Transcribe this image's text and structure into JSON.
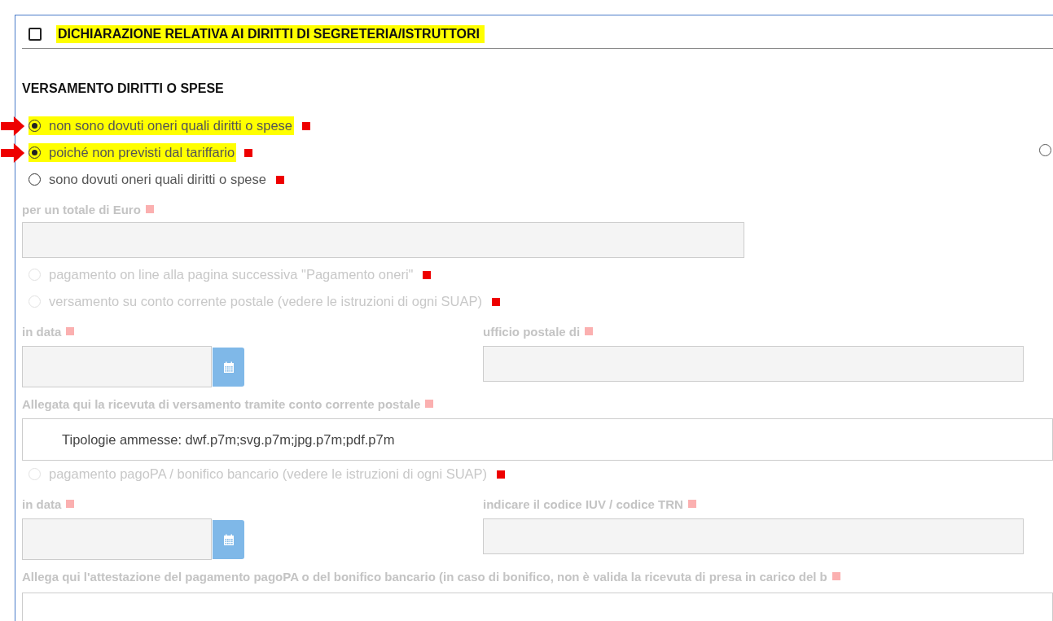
{
  "section": {
    "title": "DICHIARAZIONE RELATIVA AI DIRITTI DI SEGRETERIA/ISTRUTTORI",
    "checked": false,
    "highlighted": true
  },
  "heading": "VERSAMENTO DIRITTI O SPESE",
  "side_radio": {
    "selected": false
  },
  "rows": [
    {
      "kind": "radio",
      "label": "non sono dovuti oneri quali diritti o spese",
      "selected": true,
      "disabled": false,
      "highlighted": true,
      "arrow": true
    },
    {
      "kind": "radio",
      "label": "poiché non previsti dal tariffario",
      "selected": true,
      "disabled": false,
      "highlighted": true,
      "arrow": true
    },
    {
      "kind": "radio",
      "label": "sono dovuti oneri quali diritti o spese",
      "selected": false,
      "disabled": false,
      "highlighted": false,
      "arrow": false
    },
    {
      "kind": "field",
      "label": "per un totale di Euro",
      "disabled": true
    },
    {
      "kind": "radio",
      "label": "pagamento on line alla pagina successiva \"Pagamento oneri\"",
      "selected": false,
      "disabled": true,
      "highlighted": false,
      "arrow": false
    },
    {
      "kind": "radio",
      "label": "versamento su conto corrente postale (vedere le istruzioni di ogni SUAP)",
      "selected": false,
      "disabled": true,
      "highlighted": false,
      "arrow": false
    },
    {
      "kind": "pair",
      "left": {
        "label": "in data",
        "disabled": true
      },
      "right": {
        "label": "ufficio postale di",
        "disabled": true
      }
    },
    {
      "kind": "file",
      "label": "Allegata qui la ricevuta di versamento tramite conto corrente postale",
      "disabled": true,
      "placeholder": "Tipologie ammesse: dwf.p7m;svg.p7m;jpg.p7m;pdf.p7m"
    },
    {
      "kind": "radio",
      "label": "pagamento pagoPA / bonifico bancario (vedere le istruzioni di ogni SUAP)",
      "selected": false,
      "disabled": true,
      "highlighted": false,
      "arrow": false
    },
    {
      "kind": "pair",
      "left": {
        "label": "in data",
        "disabled": true
      },
      "right": {
        "label": "indicare il codice IUV / codice TRN",
        "disabled": true
      }
    },
    {
      "kind": "file",
      "label": "Allega qui l'attestazione del pagamento pagoPA o del bonifico bancario (in caso di bonifico, non è valida la ricevuta di presa in carico del b",
      "disabled": true
    }
  ]
}
